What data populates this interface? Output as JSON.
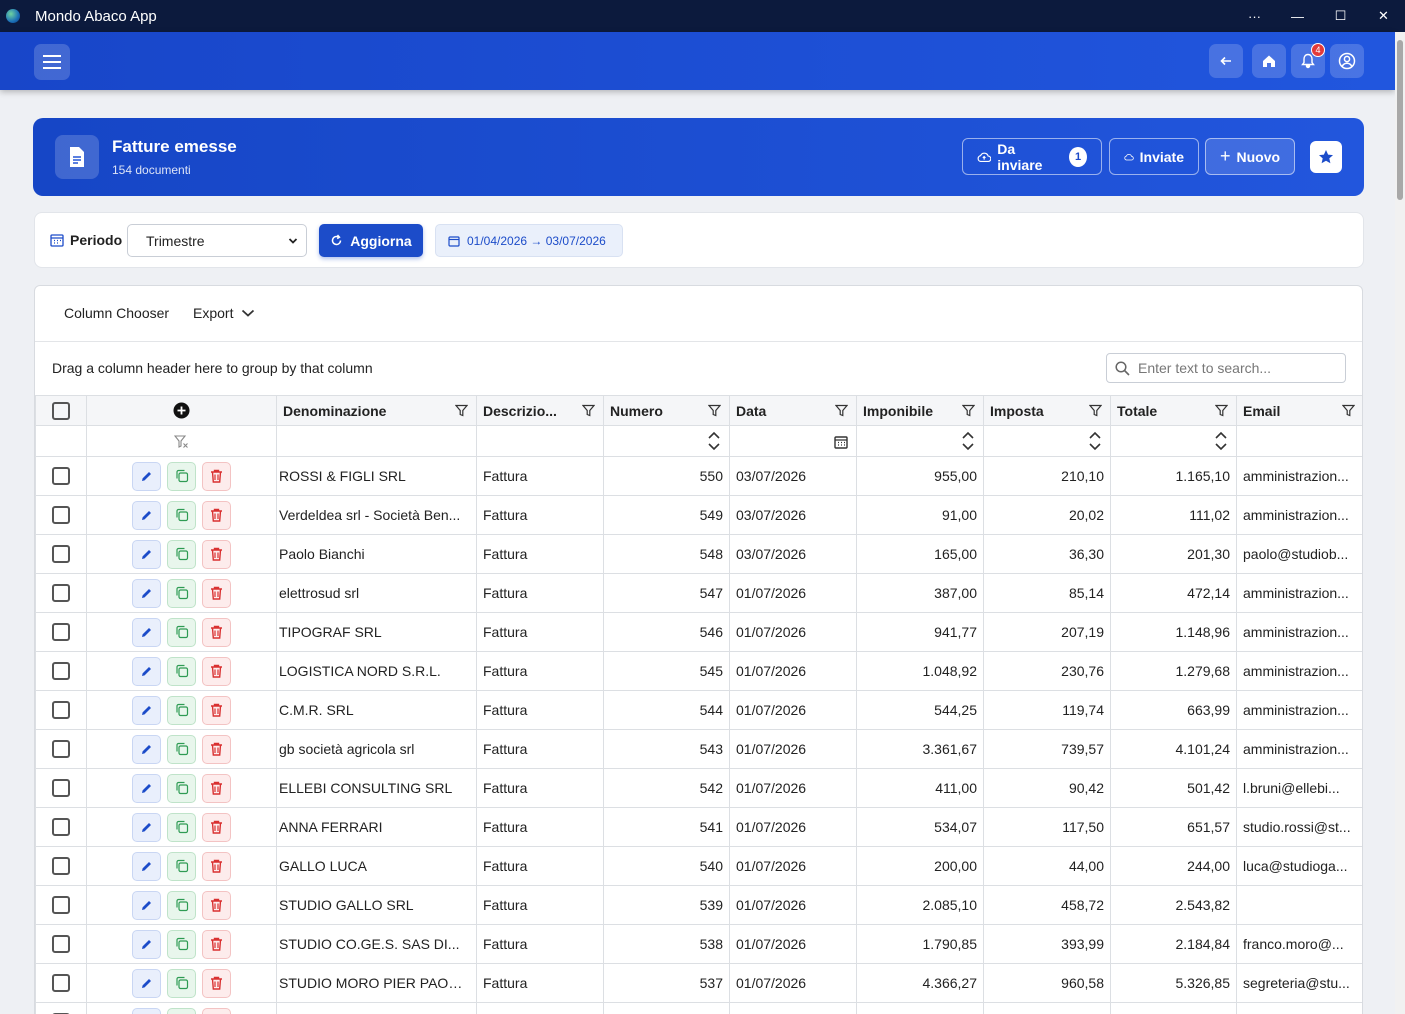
{
  "window": {
    "title": "Mondo Abaco App",
    "controls": [
      "···",
      "—",
      "☐",
      "✕"
    ]
  },
  "header": {
    "notifications_count": "4"
  },
  "hero": {
    "title": "Fatture emesse",
    "subtitle": "154 documenti",
    "btn_to_send": "Da inviare",
    "btn_to_send_count": "1",
    "btn_sent": "Inviate",
    "btn_new": "Nuovo"
  },
  "filter": {
    "period_label": "Periodo",
    "period_value": "Trimestre",
    "refresh_label": "Aggiorna",
    "date_range": "01/04/2026 → 03/07/2026"
  },
  "grid": {
    "toolbar": {
      "column_chooser": "Column Chooser",
      "export": "Export"
    },
    "group_panel": "Drag a column header here to group by that column",
    "search_placeholder": "Enter text to search...",
    "columns": [
      "Denominazione",
      "Descrizio...",
      "Numero",
      "Data",
      "Imponibile",
      "Imposta",
      "Totale",
      "Email"
    ],
    "rows": [
      [
        "ROSSI & FIGLI SRL",
        "Fattura",
        "550",
        "03/07/2026",
        "955,00",
        "210,10",
        "1.165,10",
        "amministrazion..."
      ],
      [
        "Verdeldea srl - Società Ben...",
        "Fattura",
        "549",
        "03/07/2026",
        "91,00",
        "20,02",
        "111,02",
        "amministrazion..."
      ],
      [
        "Paolo Bianchi",
        "Fattura",
        "548",
        "03/07/2026",
        "165,00",
        "36,30",
        "201,30",
        "paolo@studiob..."
      ],
      [
        "elettrosud srl",
        "Fattura",
        "547",
        "01/07/2026",
        "387,00",
        "85,14",
        "472,14",
        "amministrazion..."
      ],
      [
        "TIPOGRAF SRL",
        "Fattura",
        "546",
        "01/07/2026",
        "941,77",
        "207,19",
        "1.148,96",
        "amministrazion..."
      ],
      [
        "LOGISTICA NORD S.R.L.",
        "Fattura",
        "545",
        "01/07/2026",
        "1.048,92",
        "230,76",
        "1.279,68",
        "amministrazion..."
      ],
      [
        "C.M.R. SRL",
        "Fattura",
        "544",
        "01/07/2026",
        "544,25",
        "119,74",
        "663,99",
        "amministrazion..."
      ],
      [
        "gb società agricola srl",
        "Fattura",
        "543",
        "01/07/2026",
        "3.361,67",
        "739,57",
        "4.101,24",
        "amministrazion..."
      ],
      [
        "ELLEBI CONSULTING SRL",
        "Fattura",
        "542",
        "01/07/2026",
        "411,00",
        "90,42",
        "501,42",
        "l.bruni@ellebi..."
      ],
      [
        "ANNA FERRARI",
        "Fattura",
        "541",
        "01/07/2026",
        "534,07",
        "117,50",
        "651,57",
        "studio.rossi@st..."
      ],
      [
        "GALLO LUCA",
        "Fattura",
        "540",
        "01/07/2026",
        "200,00",
        "44,00",
        "244,00",
        "luca@studioga..."
      ],
      [
        "STUDIO GALLO SRL",
        "Fattura",
        "539",
        "01/07/2026",
        "2.085,10",
        "458,72",
        "2.543,82",
        ""
      ],
      [
        "STUDIO CO.GE.S. SAS DI...",
        "Fattura",
        "538",
        "01/07/2026",
        "1.790,85",
        "393,99",
        "2.184,84",
        "franco.moro@..."
      ],
      [
        "STUDIO MORO PIER PAOLO...",
        "Fattura",
        "537",
        "01/07/2026",
        "4.366,27",
        "960,58",
        "5.326,85",
        "segreteria@stu..."
      ],
      [
        "",
        "",
        "",
        "",
        "",
        "",
        "",
        ""
      ]
    ]
  },
  "colors": {
    "primary": "#1c4cc9",
    "titlebar": "#0c1a3d",
    "edit": "#1c4cc9",
    "copy": "#2e9b53",
    "delete": "#d93030"
  }
}
